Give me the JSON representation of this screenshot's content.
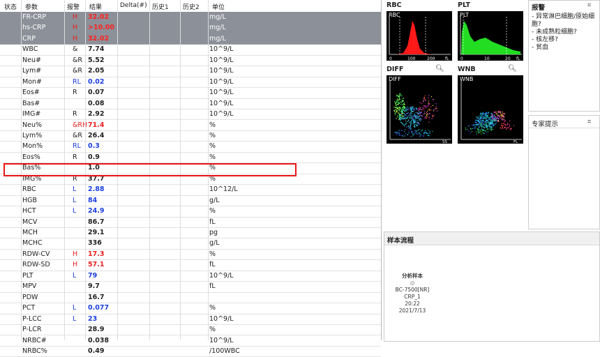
{
  "headers": {
    "status": "状态",
    "param": "参数",
    "alarm": "报警",
    "result": "结果",
    "delta": "Delta(#)",
    "hist1": "历史1",
    "hist2": "历史2",
    "unit": "单位"
  },
  "rows": [
    {
      "param": "FR-CRP",
      "flag": "H",
      "result": "32.02",
      "unit": "mg/L",
      "gray": true,
      "color": "red"
    },
    {
      "param": "hs-CRP",
      "flag": "H",
      "result": ">10.00",
      "unit": "mg/L",
      "gray": true,
      "color": "red"
    },
    {
      "param": "CRP",
      "flag": "H",
      "result": "32.02",
      "unit": "mg/L",
      "gray": true,
      "color": "red"
    },
    {
      "param": "WBC",
      "flag": "&",
      "result": "7.74",
      "unit": "10^9/L",
      "color": ""
    },
    {
      "param": "Neu#",
      "flag": "&R",
      "result": "5.52",
      "unit": "10^9/L",
      "color": ""
    },
    {
      "param": "Lym#",
      "flag": "&R",
      "result": "2.05",
      "unit": "10^9/L",
      "color": ""
    },
    {
      "param": "Mon#",
      "flag": "RL",
      "result": "0.02",
      "unit": "10^9/L",
      "color": "blue"
    },
    {
      "param": "Eos#",
      "flag": "R",
      "result": "0.07",
      "unit": "10^9/L",
      "color": ""
    },
    {
      "param": "Bas#",
      "flag": "",
      "result": "0.08",
      "unit": "10^9/L",
      "color": ""
    },
    {
      "param": "IMG#",
      "flag": "R",
      "result": "2.92",
      "unit": "10^9/L",
      "color": ""
    },
    {
      "param": "Neu%",
      "flag": "&RH",
      "result": "71.4",
      "unit": "%",
      "color": "red"
    },
    {
      "param": "Lym%",
      "flag": "&R",
      "result": "26.4",
      "unit": "%",
      "color": ""
    },
    {
      "param": "Mon%",
      "flag": "RL",
      "result": "0.3",
      "unit": "%",
      "color": "blue"
    },
    {
      "param": "Eos%",
      "flag": "R",
      "result": "0.9",
      "unit": "%",
      "color": ""
    },
    {
      "param": "Bas%",
      "flag": "",
      "result": "1.0",
      "unit": "%",
      "color": ""
    },
    {
      "param": "IMG%",
      "flag": "R",
      "result": "37.7",
      "unit": "%",
      "color": ""
    },
    {
      "param": "RBC",
      "flag": "L",
      "result": "2.88",
      "unit": "10^12/L",
      "color": "blue"
    },
    {
      "param": "HGB",
      "flag": "L",
      "result": "84",
      "unit": "g/L",
      "color": "blue"
    },
    {
      "param": "HCT",
      "flag": "L",
      "result": "24.9",
      "unit": "%",
      "color": "blue"
    },
    {
      "param": "MCV",
      "flag": "",
      "result": "86.7",
      "unit": "fL",
      "color": ""
    },
    {
      "param": "MCH",
      "flag": "",
      "result": "29.1",
      "unit": "pg",
      "color": ""
    },
    {
      "param": "MCHC",
      "flag": "",
      "result": "336",
      "unit": "g/L",
      "color": ""
    },
    {
      "param": "RDW-CV",
      "flag": "H",
      "result": "17.3",
      "unit": "%",
      "color": "red"
    },
    {
      "param": "RDW-SD",
      "flag": "H",
      "result": "57.1",
      "unit": "fL",
      "color": "red"
    },
    {
      "param": "PLT",
      "flag": "L",
      "result": "79",
      "unit": "10^9/L",
      "color": "blue"
    },
    {
      "param": "MPV",
      "flag": "",
      "result": "9.7",
      "unit": "fL",
      "color": ""
    },
    {
      "param": "PDW",
      "flag": "",
      "result": "16.7",
      "unit": "",
      "color": ""
    },
    {
      "param": "PCT",
      "flag": "L",
      "result": "0.077",
      "unit": "%",
      "color": "blue"
    },
    {
      "param": "P-LCC",
      "flag": "L",
      "result": "23",
      "unit": "10^9/L",
      "color": "blue"
    },
    {
      "param": "P-LCR",
      "flag": "",
      "result": "28.9",
      "unit": "%",
      "color": ""
    },
    {
      "param": "NRBC#",
      "flag": "",
      "result": "0.038",
      "unit": "10^9/L",
      "color": ""
    },
    {
      "param": "NRBC%",
      "flag": "",
      "result": "0.49",
      "unit": "/100WBC",
      "color": ""
    }
  ],
  "panels": {
    "rbc": {
      "title": "RBC",
      "plot_label": "RBC",
      "color": "#ff1a1a"
    },
    "plt": {
      "title": "PLT",
      "plot_label": "PLT",
      "color": "#22dd22",
      "ticks": [
        "0",
        "10",
        "20",
        "fL"
      ]
    },
    "diff": {
      "title": "DIFF",
      "plot_label": "DIFF",
      "axis": "SS"
    },
    "wnb": {
      "title": "WNB",
      "plot_label": "WNB",
      "axis": "FL"
    },
    "rbc_ticks": [
      "0",
      "100",
      "200",
      "fL"
    ]
  },
  "alarm": {
    "title": "报警",
    "items": [
      "- 异常淋巴细胞/原始细胞?",
      "- 未成熟粒细胞?",
      "- 核左移?",
      "- 贫血"
    ]
  },
  "expert": {
    "title": "专家提示"
  },
  "flow": {
    "title": "样本流程",
    "step": "分析样本",
    "device": "BC-7500[NR]",
    "mode": "CRP_1",
    "time": "20:22",
    "date": "2021/7/13"
  },
  "icons": {
    "zoom": "magnifier-icon",
    "close": "close-icon"
  }
}
